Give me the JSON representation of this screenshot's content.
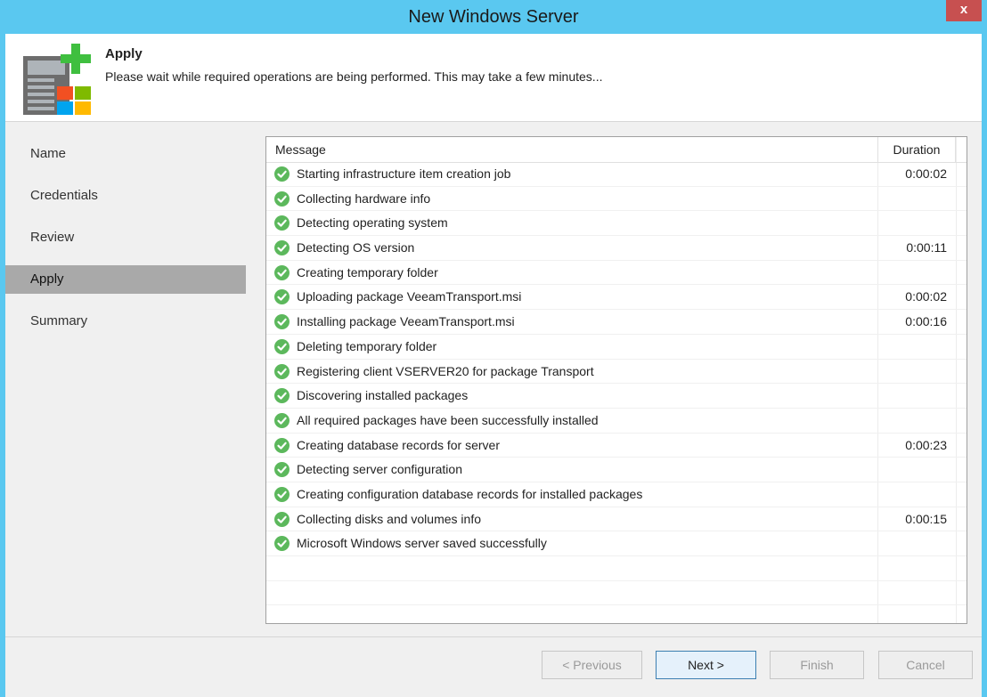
{
  "window": {
    "title": "New Windows Server",
    "close_label": "x"
  },
  "header": {
    "title": "Apply",
    "description": "Please wait while required operations are being performed. This may take a few minutes..."
  },
  "nav": {
    "items": [
      {
        "label": "Name"
      },
      {
        "label": "Credentials"
      },
      {
        "label": "Review"
      },
      {
        "label": "Apply"
      },
      {
        "label": "Summary"
      }
    ],
    "active": "Apply"
  },
  "log": {
    "columns": {
      "message": "Message",
      "duration": "Duration"
    },
    "rows": [
      {
        "status": "success",
        "message": "Starting infrastructure item creation job",
        "duration": "0:00:02"
      },
      {
        "status": "success",
        "message": "Collecting hardware info",
        "duration": ""
      },
      {
        "status": "success",
        "message": "Detecting operating system",
        "duration": ""
      },
      {
        "status": "success",
        "message": "Detecting OS version",
        "duration": "0:00:11"
      },
      {
        "status": "success",
        "message": "Creating temporary folder",
        "duration": ""
      },
      {
        "status": "success",
        "message": "Uploading package VeeamTransport.msi",
        "duration": "0:00:02"
      },
      {
        "status": "success",
        "message": "Installing package VeeamTransport.msi",
        "duration": "0:00:16"
      },
      {
        "status": "success",
        "message": "Deleting temporary folder",
        "duration": ""
      },
      {
        "status": "success",
        "message": "Registering client VSERVER20 for package Transport",
        "duration": ""
      },
      {
        "status": "success",
        "message": "Discovering installed packages",
        "duration": ""
      },
      {
        "status": "success",
        "message": "All required packages have been successfully installed",
        "duration": ""
      },
      {
        "status": "success",
        "message": "Creating database records for server",
        "duration": "0:00:23"
      },
      {
        "status": "success",
        "message": "Detecting server configuration",
        "duration": ""
      },
      {
        "status": "success",
        "message": "Creating configuration database records for installed packages",
        "duration": ""
      },
      {
        "status": "success",
        "message": "Collecting disks and volumes info",
        "duration": "0:00:15"
      },
      {
        "status": "success",
        "message": "Microsoft Windows server saved successfully",
        "duration": ""
      }
    ]
  },
  "buttons": {
    "previous": "< Previous",
    "next": "Next >",
    "finish": "Finish",
    "cancel": "Cancel"
  },
  "colors": {
    "titlebar": "#5ac8f0",
    "success": "#5cb85c",
    "active_nav": "#a9a9a9"
  }
}
